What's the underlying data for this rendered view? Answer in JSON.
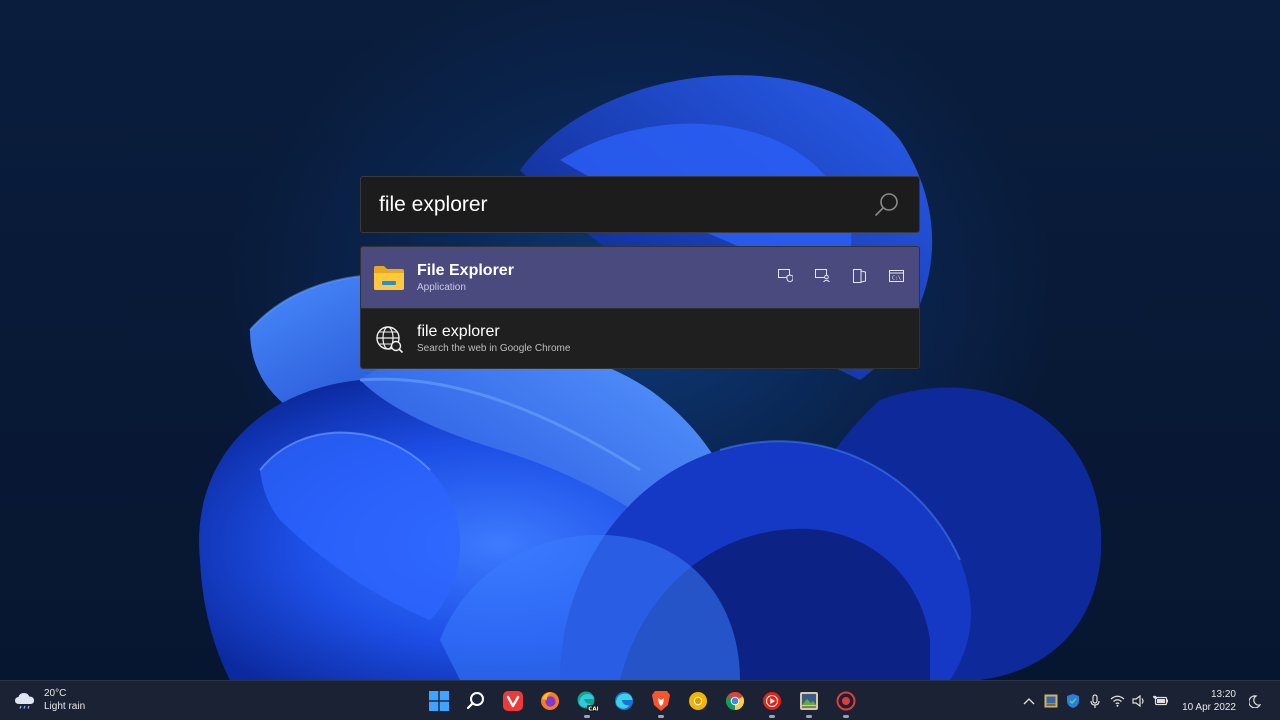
{
  "launcher": {
    "query": "file explorer",
    "results": [
      {
        "title": "File Explorer",
        "subtitle": "Application",
        "icon": "folder-icon",
        "selected": true,
        "actions": [
          "run-as-admin-icon",
          "run-as-user-icon",
          "open-containing-folder-icon",
          "open-in-console-icon"
        ]
      },
      {
        "title": "file explorer",
        "subtitle": "Search the web in Google Chrome",
        "icon": "web-search-icon",
        "selected": false
      }
    ]
  },
  "taskbar": {
    "weather": {
      "temp": "20°C",
      "condition": "Light rain",
      "icon": "cloud-rain-icon"
    },
    "apps": [
      {
        "name": "start-button",
        "icon": "windows-logo-icon",
        "running": false
      },
      {
        "name": "search-button",
        "icon": "search-icon",
        "running": false
      },
      {
        "name": "vivaldi",
        "icon": "vivaldi-icon",
        "running": false
      },
      {
        "name": "firefox",
        "icon": "firefox-icon",
        "running": false
      },
      {
        "name": "edge-canary",
        "icon": "edge-can-icon",
        "running": true
      },
      {
        "name": "edge",
        "icon": "edge-icon",
        "running": false
      },
      {
        "name": "brave",
        "icon": "brave-icon",
        "running": true
      },
      {
        "name": "chrome-canary",
        "icon": "chrome-canary-icon",
        "running": false
      },
      {
        "name": "chrome",
        "icon": "chrome-icon",
        "running": false
      },
      {
        "name": "youtube-music",
        "icon": "youtube-music-icon",
        "running": true
      },
      {
        "name": "photo-app",
        "icon": "photo-icon",
        "running": true
      },
      {
        "name": "screen-recorder",
        "icon": "record-icon",
        "running": true
      }
    ],
    "tray": [
      "chevron-up-icon",
      "app-tray-icon",
      "defender-icon",
      "microphone-icon",
      "wifi-icon",
      "volume-icon",
      "battery-icon"
    ],
    "clock": {
      "time": "13:20",
      "date": "10 Apr 2022"
    }
  },
  "colors": {
    "selected_row": "#4a4a7e",
    "panel_bg": "#1f1f1f",
    "taskbar_bg": "#1a2233",
    "wallpaper_blue": "#1f4fe0"
  }
}
